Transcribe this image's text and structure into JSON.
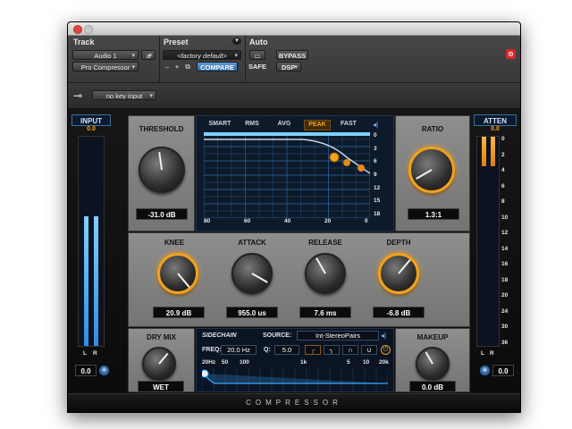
{
  "header": {
    "track_label": "Track",
    "preset_label": "Preset",
    "auto_label": "Auto",
    "track_name": "Audio 1",
    "track_channel": "a",
    "plugin_name": "Pro Compressor",
    "preset_name": "<factory default>",
    "compare_label": "COMPARE",
    "safe_label": "SAFE",
    "bypass_label": "BYPASS",
    "dsp_label": "DSP",
    "key_input": "no key input",
    "minus_label": "–",
    "plus_label": "+"
  },
  "input_meter": {
    "label": "INPUT",
    "peak": "0.0",
    "value": "0.0",
    "left_label": "L",
    "right_label": "R",
    "level": 0.62
  },
  "atten_meter": {
    "label": "ATTEN",
    "peak": "0.0",
    "value": "0.0",
    "left_label": "L",
    "right_label": "R",
    "scale": [
      "0",
      "2",
      "4",
      "6",
      "8",
      "10",
      "12",
      "14",
      "16",
      "18",
      "20",
      "24",
      "30",
      "36"
    ],
    "level": 0.14
  },
  "graph": {
    "modes": [
      "SMART",
      "RMS",
      "AVG",
      "PEAK",
      "FAST"
    ],
    "active_mode": "PEAK",
    "x_ticks": [
      "80",
      "60",
      "40",
      "20",
      "0"
    ],
    "y_ticks": [
      "0",
      "3",
      "6",
      "9",
      "12",
      "15",
      "18"
    ]
  },
  "controls": {
    "threshold": {
      "label": "THRESHOLD",
      "value": "-31.0 dB"
    },
    "ratio": {
      "label": "RATIO",
      "value": "1.3:1"
    },
    "knee": {
      "label": "KNEE",
      "value": "20.9 dB"
    },
    "attack": {
      "label": "ATTACK",
      "value": "955.0 us"
    },
    "release": {
      "label": "RELEASE",
      "value": "7.6 ms"
    },
    "depth": {
      "label": "DEPTH",
      "value": "-6.8 dB"
    },
    "dry_mix": {
      "label": "DRY MIX",
      "value": "WET"
    },
    "makeup": {
      "label": "MAKEUP",
      "value": "0.0 dB"
    }
  },
  "sidechain": {
    "title": "SIDECHAIN",
    "source_label": "SOURCE:",
    "source_value": "Int-StereoPairs",
    "freq_label": "FREQ:",
    "freq_value": "20.0 Hz",
    "q_label": "Q:",
    "q_value": "5.0",
    "freq_scale": [
      "20Hz",
      "50",
      "100",
      "1k",
      "5",
      "10",
      "20k"
    ]
  },
  "footer": {
    "product_name": "COMPRESSOR"
  },
  "colors": {
    "accent": "#f7a31c",
    "meter_blue": "#3aa7ff",
    "plugin_red": "#d8262a"
  }
}
